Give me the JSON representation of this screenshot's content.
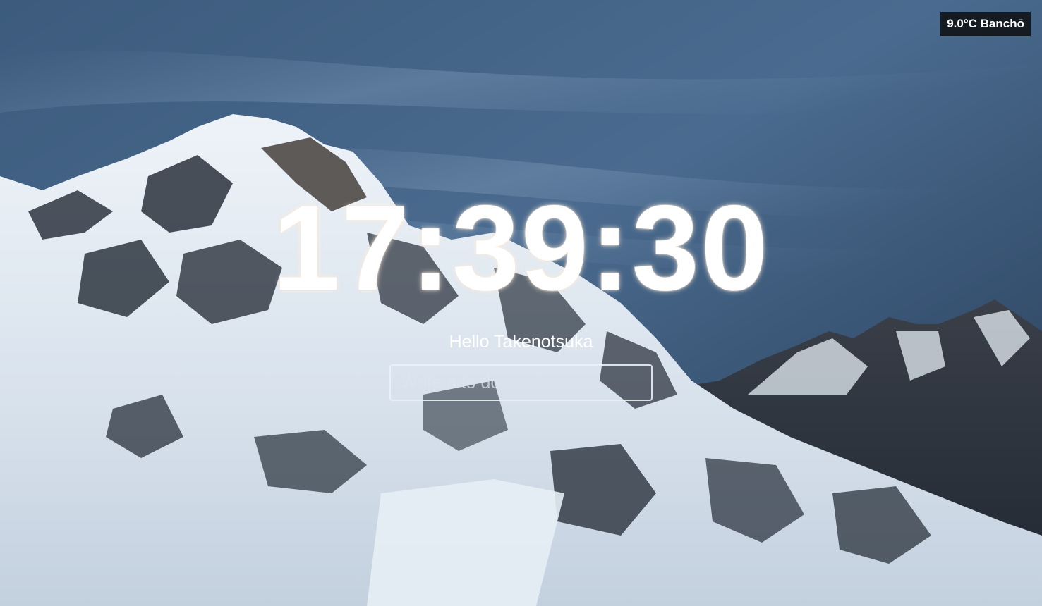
{
  "weather": {
    "text": "9.0°C Banchō"
  },
  "clock": {
    "time": "17:39:30"
  },
  "greeting": {
    "text": "Hello Takenotsuka"
  },
  "todo": {
    "placeholder": "Write a to do",
    "value": ""
  },
  "colors": {
    "sky": "#3a5676",
    "weather_bg": "#161b22",
    "text": "#ffffff"
  }
}
